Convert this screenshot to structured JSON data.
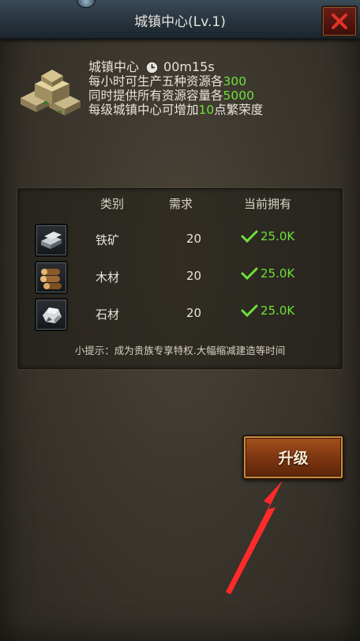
{
  "header": {
    "title": "城镇中心(Lv.1)"
  },
  "building": {
    "name": "城镇中心",
    "timer": "00m15s",
    "line1_prefix": "每小时可生产五种资源各",
    "line1_value": "300",
    "line2_prefix": "同时提供所有资源容量各",
    "line2_value": "5000",
    "line3_prefix": "每级城镇中心可增加",
    "line3_value": "10",
    "line3_suffix": "点繁荣度"
  },
  "requirements": {
    "headers": {
      "category": "类别",
      "required": "需求",
      "owned": "当前拥有"
    },
    "rows": [
      {
        "icon": "iron-ore-icon",
        "name": "铁矿",
        "required": "20",
        "owned": "25.0K"
      },
      {
        "icon": "wood-log-icon",
        "name": "木材",
        "required": "20",
        "owned": "25.0K"
      },
      {
        "icon": "stone-icon",
        "name": "石材",
        "required": "20",
        "owned": "25.0K"
      }
    ],
    "tip": "小提示：成为贵族专享特权.大幅缩减建造等时间"
  },
  "actions": {
    "upgrade_label": "升级"
  },
  "colors": {
    "accent_green": "#6fe03a",
    "button_orange": "#8a3c12",
    "annotation_arrow": "#ff2a2a"
  }
}
